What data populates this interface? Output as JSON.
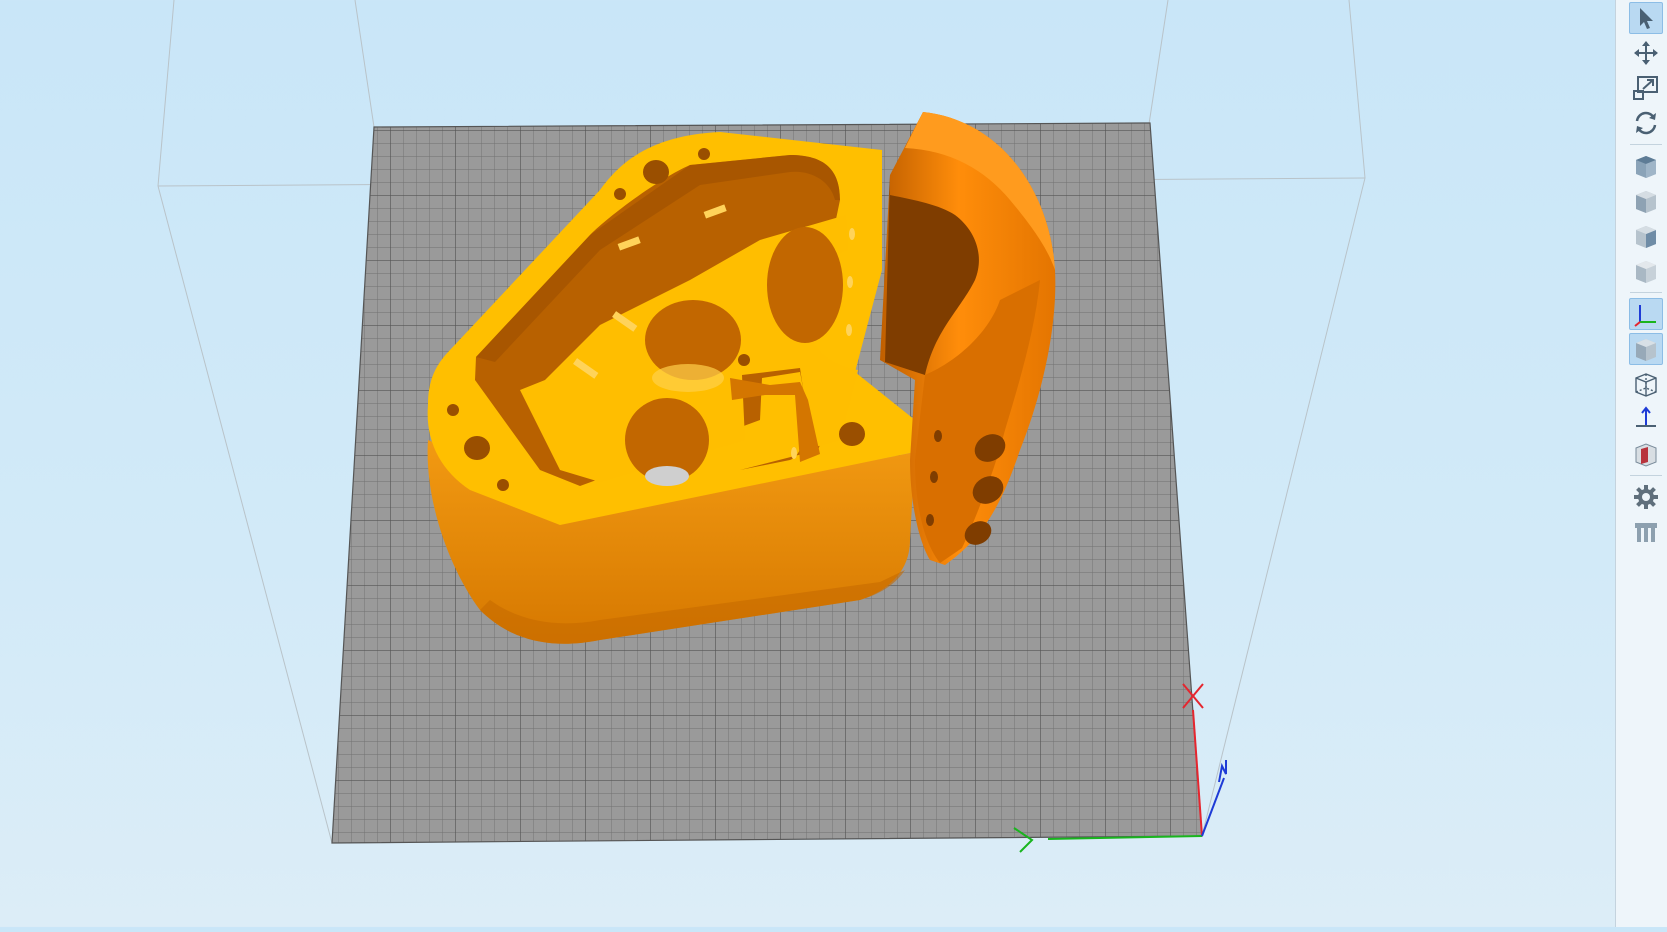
{
  "viewport": {
    "background_color": "#cbe7f8",
    "bed_color": "#9a9a9a",
    "grid_line_color": "#6f6f6f",
    "model_top_color": "#ffc107",
    "model_side_color": "#e8890a",
    "model_dark_color": "#b85f00",
    "part_color": "#ff8a00",
    "axes": [
      {
        "name": "x",
        "color": "#e5262f"
      },
      {
        "name": "y",
        "color": "#19b51e"
      },
      {
        "name": "z",
        "color": "#1e3bd6"
      }
    ]
  },
  "toolbar": {
    "tools": [
      {
        "name": "select-tool",
        "icon": "cursor-icon",
        "active": true
      },
      {
        "name": "move-tool",
        "icon": "move-icon",
        "active": false
      },
      {
        "name": "scale-tool",
        "icon": "scale-icon",
        "active": false
      },
      {
        "name": "rotate-tool",
        "icon": "rotate-icon",
        "active": false
      },
      {
        "name": "view-top",
        "icon": "cube-top-icon",
        "active": false
      },
      {
        "name": "view-front",
        "icon": "cube-front-icon",
        "active": false
      },
      {
        "name": "view-side",
        "icon": "cube-side-icon",
        "active": false
      },
      {
        "name": "view-iso",
        "icon": "cube-iso-icon",
        "active": false
      },
      {
        "name": "show-axes",
        "icon": "axes-icon",
        "active": true
      },
      {
        "name": "solid-view",
        "icon": "solid-cube-icon",
        "active": true
      },
      {
        "name": "wireframe-view",
        "icon": "wireframe-cube-icon",
        "active": false
      },
      {
        "name": "place-on-bed",
        "icon": "drop-to-bed-icon",
        "active": false
      },
      {
        "name": "cut-view",
        "icon": "section-cube-icon",
        "active": false
      },
      {
        "name": "settings",
        "icon": "gear-icon",
        "active": false
      },
      {
        "name": "supports",
        "icon": "supports-icon",
        "active": false
      }
    ]
  }
}
